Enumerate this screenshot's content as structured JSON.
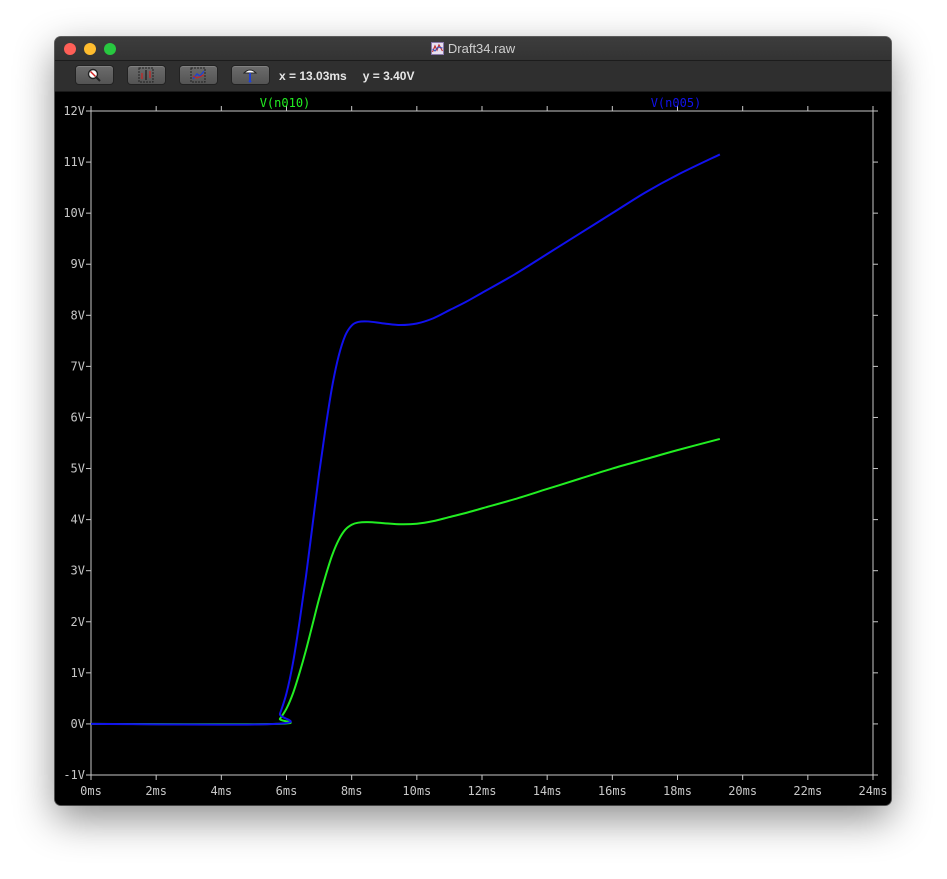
{
  "window": {
    "title": "Draft34.raw"
  },
  "toolbar": {
    "buttons": [
      {
        "icon": "zoom-icon"
      },
      {
        "icon": "autorange-icon"
      },
      {
        "icon": "pan-icon"
      },
      {
        "icon": "probe-icon"
      }
    ],
    "cursor_x": "x = 13.03ms",
    "cursor_y": "y = 3.40V"
  },
  "colors": {
    "background": "#000000",
    "axis": "#c8c8c8",
    "n010": "#22ee22",
    "n005": "#1111ee"
  },
  "chart_data": {
    "type": "line",
    "title": "",
    "xlabel": "",
    "ylabel": "",
    "xlim": [
      0,
      24
    ],
    "ylim": [
      -1,
      12
    ],
    "x_unit": "ms",
    "y_unit": "V",
    "x_ticks": [
      "0ms",
      "2ms",
      "4ms",
      "6ms",
      "8ms",
      "10ms",
      "12ms",
      "14ms",
      "16ms",
      "18ms",
      "20ms",
      "22ms",
      "24ms"
    ],
    "y_ticks": [
      "12V",
      "11V",
      "10V",
      "9V",
      "8V",
      "7V",
      "6V",
      "5V",
      "4V",
      "3V",
      "2V",
      "1V",
      "0V",
      "-1V"
    ],
    "grid": false,
    "legend": "top",
    "series": [
      {
        "name": "V(n010)",
        "color": "#22ee22",
        "x": [
          0,
          5.68,
          5.8,
          6.0,
          6.2,
          6.4,
          6.6,
          6.8,
          7.0,
          7.2,
          7.4,
          7.6,
          7.8,
          8.0,
          8.2,
          8.5,
          9.0,
          9.5,
          10.0,
          10.5,
          11.0,
          11.5,
          12.0,
          13.0,
          14.0,
          15.0,
          16.0,
          17.0,
          18.0,
          19.3
        ],
        "y": [
          0,
          0,
          0.1,
          0.3,
          0.6,
          1.0,
          1.45,
          1.95,
          2.45,
          2.9,
          3.3,
          3.6,
          3.8,
          3.9,
          3.94,
          3.95,
          3.93,
          3.91,
          3.92,
          3.97,
          4.05,
          4.13,
          4.22,
          4.4,
          4.6,
          4.8,
          5.0,
          5.18,
          5.36,
          5.58
        ]
      },
      {
        "name": "V(n005)",
        "color": "#1111ee",
        "x": [
          0,
          5.68,
          5.8,
          6.0,
          6.2,
          6.4,
          6.6,
          6.8,
          7.0,
          7.2,
          7.4,
          7.6,
          7.8,
          8.0,
          8.2,
          8.5,
          9.0,
          9.5,
          10.0,
          10.5,
          11.0,
          11.5,
          12.0,
          13.0,
          14.0,
          15.0,
          16.0,
          17.0,
          18.0,
          19.3
        ],
        "y": [
          0,
          0,
          0.2,
          0.6,
          1.2,
          2.0,
          2.9,
          3.9,
          4.9,
          5.8,
          6.6,
          7.2,
          7.6,
          7.8,
          7.87,
          7.88,
          7.84,
          7.81,
          7.84,
          7.94,
          8.1,
          8.26,
          8.44,
          8.8,
          9.2,
          9.6,
          10.0,
          10.4,
          10.75,
          11.15
        ]
      }
    ]
  }
}
